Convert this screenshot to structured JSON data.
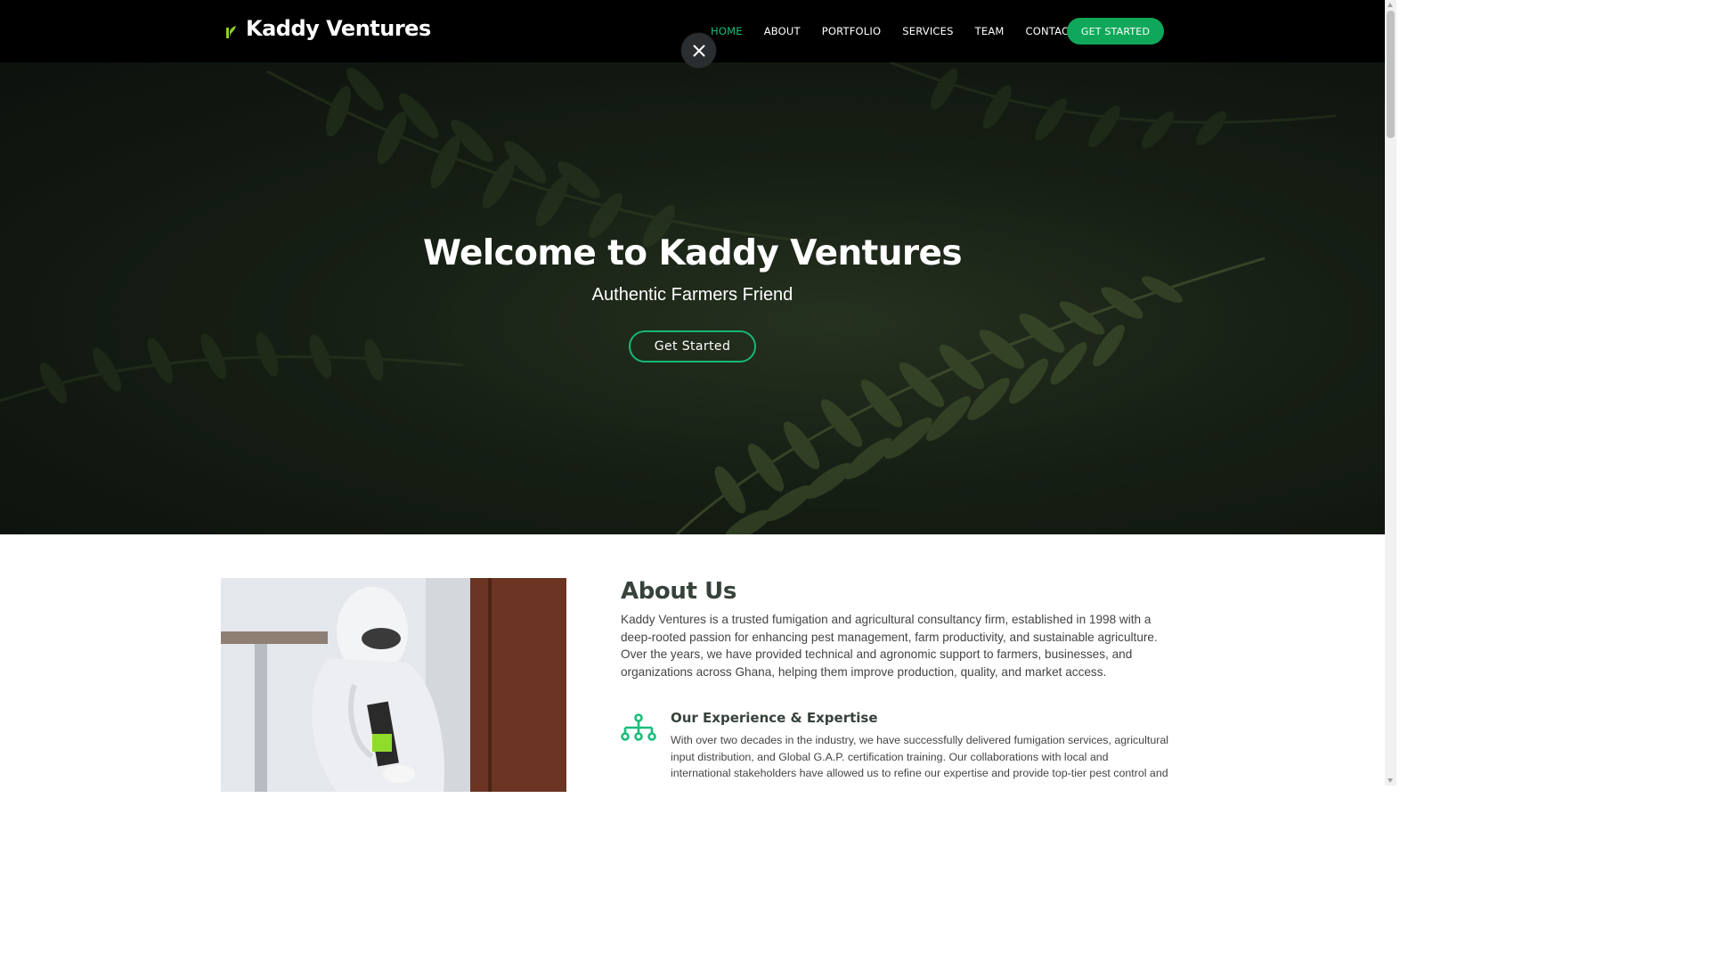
{
  "header": {
    "logo_text": "Kaddy Ventures",
    "nav": [
      {
        "label": "HOME",
        "active": true
      },
      {
        "label": "ABOUT",
        "active": false
      },
      {
        "label": "PORTFOLIO",
        "active": false
      },
      {
        "label": "SERVICES",
        "active": false
      },
      {
        "label": "TEAM",
        "active": false
      },
      {
        "label": "CONTACT",
        "active": false
      }
    ],
    "cta_label": "GET STARTED"
  },
  "overlay": {
    "close_icon": "close-icon"
  },
  "hero": {
    "title": "Welcome to Kaddy Ventures",
    "subtitle": "Authentic Farmers Friend",
    "button_label": "Get Started"
  },
  "about": {
    "title": "About Us",
    "body": "Kaddy Ventures is a trusted fumigation and agricultural consultancy firm, established in 1998 with a deep-rooted passion for enhancing pest management, farm productivity, and sustainable agriculture. Over the years, we have provided technical and agronomic support to farmers, businesses, and organizations across Ghana, helping them improve production, quality, and market access.",
    "experience": {
      "icon": "network-icon",
      "title": "Our Experience & Expertise",
      "body": "With over two decades in the industry, we have successfully delivered fumigation services, agricultural input distribution, and Global G.A.P. certification training. Our collaborations with local and international stakeholders have allowed us to refine our expertise and provide top-tier pest control and"
    }
  },
  "colors": {
    "accent": "#0fa85a",
    "nav_active": "#1bbd7a",
    "header_bg": "#000000",
    "heading": "#37423b"
  }
}
